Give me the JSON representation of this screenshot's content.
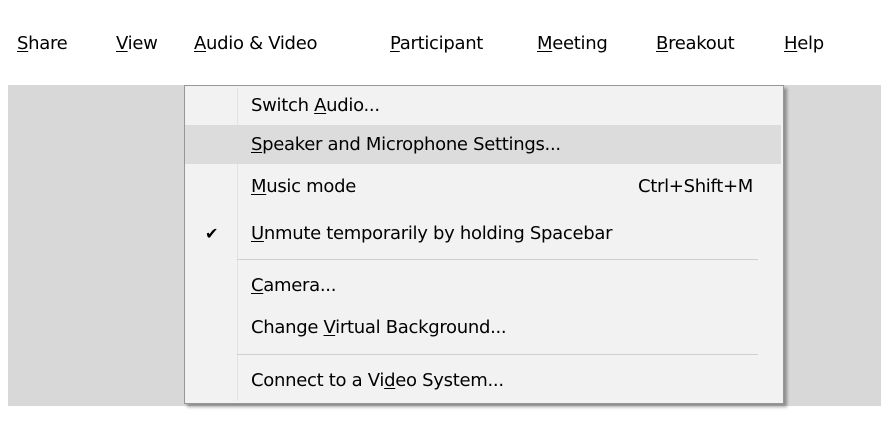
{
  "menubar": {
    "items": [
      {
        "pre": "",
        "ul": "S",
        "post": "hare"
      },
      {
        "pre": "",
        "ul": "V",
        "post": "iew"
      },
      {
        "pre": "",
        "ul": "A",
        "post": "udio & Video"
      },
      {
        "pre": "",
        "ul": "P",
        "post": "articipant"
      },
      {
        "pre": "",
        "ul": "M",
        "post": "eeting"
      },
      {
        "pre": "",
        "ul": "B",
        "post": "reakout"
      },
      {
        "pre": "",
        "ul": "H",
        "post": "elp"
      }
    ]
  },
  "dropdown": {
    "items": [
      {
        "pre": "Switch ",
        "ul": "A",
        "post": "udio...",
        "shortcut": "",
        "checked": false
      },
      {
        "pre": "",
        "ul": "S",
        "post": "peaker and Microphone Settings...",
        "shortcut": "",
        "checked": false,
        "highlighted": true
      },
      {
        "pre": "",
        "ul": "M",
        "post": "usic mode",
        "shortcut": "Ctrl+Shift+M",
        "checked": false
      },
      {
        "pre": "",
        "ul": "U",
        "post": "nmute temporarily by holding Spacebar",
        "shortcut": "",
        "checked": true
      },
      {
        "pre": "",
        "ul": "C",
        "post": "amera...",
        "shortcut": "",
        "checked": false
      },
      {
        "pre": "Change ",
        "ul": "V",
        "post": "irtual Background...",
        "shortcut": "",
        "checked": false
      },
      {
        "pre": "Connect to a Vi",
        "ul": "d",
        "post": "eo System...",
        "shortcut": "",
        "checked": false
      }
    ],
    "check_glyph": "✔"
  }
}
